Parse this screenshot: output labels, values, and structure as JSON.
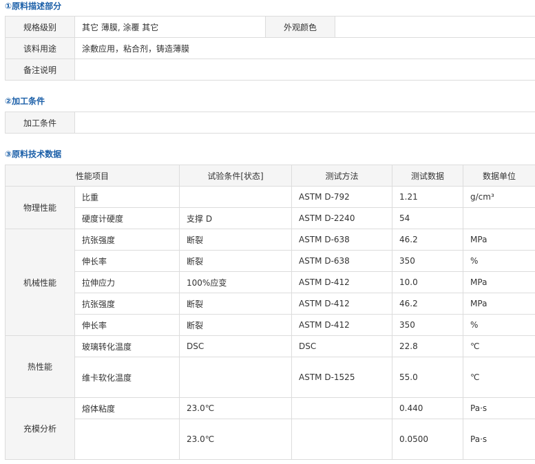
{
  "section1": {
    "title": "①原料描述部分",
    "spec_label": "规格级别",
    "spec_value": "其它 薄膜, 涂覆 其它",
    "appearance_label": "外观颜色",
    "appearance_value": "",
    "usage_label": "该料用途",
    "usage_value": "涂敷应用，粘合剂，铸造薄膜",
    "notes_label": "备注说明",
    "notes_value": ""
  },
  "section2": {
    "title": "②加工条件",
    "label": "加工条件",
    "value": ""
  },
  "section3": {
    "title": "③原料技术数据",
    "headers": [
      "性能项目",
      "试验条件[状态]",
      "测试方法",
      "测试数据",
      "数据单位"
    ],
    "groups": [
      {
        "name": "物理性能",
        "rows": [
          {
            "item": "比重",
            "condition": "",
            "method": "ASTM D-792",
            "value": "1.21",
            "unit": "g/cm³"
          },
          {
            "item": "硬度计硬度",
            "condition": "支撑 D",
            "method": "ASTM D-2240",
            "value": "54",
            "unit": ""
          }
        ]
      },
      {
        "name": "机械性能",
        "rows": [
          {
            "item": "抗张强度",
            "condition": "断裂",
            "method": "ASTM D-638",
            "value": "46.2",
            "unit": "MPa"
          },
          {
            "item": "伸长率",
            "condition": "断裂",
            "method": "ASTM D-638",
            "value": "350",
            "unit": "%"
          },
          {
            "item": "拉伸应力",
            "condition": "100%应变",
            "method": "ASTM D-412",
            "value": "10.0",
            "unit": "MPa"
          },
          {
            "item": "抗张强度",
            "condition": "断裂",
            "method": "ASTM D-412",
            "value": "46.2",
            "unit": "MPa"
          },
          {
            "item": "伸长率",
            "condition": "断裂",
            "method": "ASTM D-412",
            "value": "350",
            "unit": "%"
          }
        ]
      },
      {
        "name": "热性能",
        "rows": [
          {
            "item": "玻璃转化温度",
            "condition": "DSC",
            "method": "DSC",
            "value": "22.8",
            "unit": "℃"
          },
          {
            "item": "维卡软化温度",
            "condition": "",
            "method": "ASTM D-1525",
            "value": "55.0",
            "unit": "℃"
          }
        ]
      },
      {
        "name": "充模分析",
        "rows": [
          {
            "item": "熔体粘度",
            "condition": "23.0℃",
            "method": "",
            "value": "0.440",
            "unit": "Pa·s"
          },
          {
            "item": "",
            "condition": "23.0℃",
            "method": "",
            "value": "0.0500",
            "unit": "Pa·s"
          }
        ]
      }
    ]
  },
  "colors": {
    "section_title": "#1b5fa8",
    "label_bg": "#f5f5f5",
    "border": "#dcdcdc",
    "text": "#333333"
  }
}
